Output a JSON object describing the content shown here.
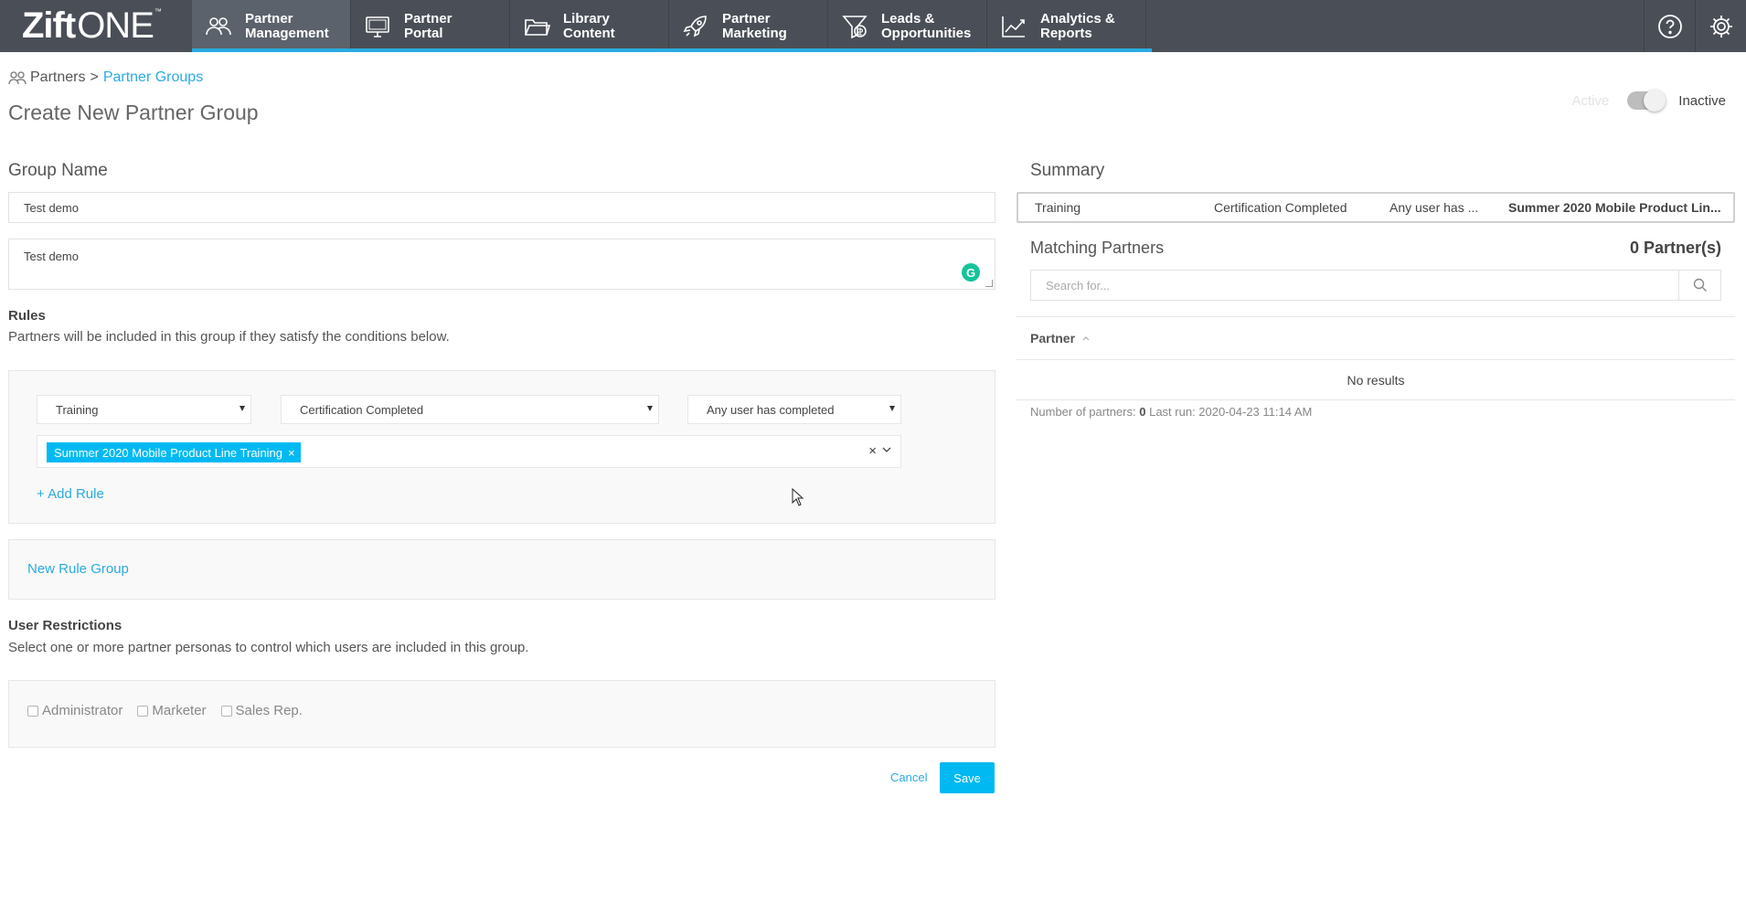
{
  "app": {
    "logo_main": "Zift",
    "logo_sub": "ONE",
    "logo_tm": "™"
  },
  "nav": {
    "tabs": [
      {
        "line1": "Partner",
        "line2": "Management",
        "icon": "partners-icon"
      },
      {
        "line1": "Partner",
        "line2": "Portal",
        "icon": "monitor-icon"
      },
      {
        "line1": "Library",
        "line2": "Content",
        "icon": "folder-icon"
      },
      {
        "line1": "Partner",
        "line2": "Marketing",
        "icon": "rocket-icon"
      },
      {
        "line1": "Leads &",
        "line2": "Opportunities",
        "icon": "money-funnel-icon"
      },
      {
        "line1": "Analytics &",
        "line2": "Reports",
        "icon": "chart-icon"
      }
    ],
    "help_icon": "help-icon",
    "settings_icon": "gear-icon",
    "accent": "#29abe2"
  },
  "breadcrumb": {
    "root": "Partners",
    "separator": ">",
    "current": "Partner Groups"
  },
  "page": {
    "title": "Create New Partner Group"
  },
  "status": {
    "active_label": "Active",
    "inactive_label": "Inactive"
  },
  "form": {
    "group_name_label": "Group Name",
    "group_name_value": "Test demo",
    "description_value": "Test demo",
    "rules_title": "Rules",
    "rules_desc": "Partners will be included in this group if they satisfy the conditions below.",
    "rule": {
      "type": "Training",
      "condition": "Certification Completed",
      "scope": "Any user has completed",
      "selected": "Summer 2020 Mobile Product Line Training",
      "chip_remove": "×",
      "clear": "×"
    },
    "add_rule": "+ Add Rule",
    "new_rule_group": "New Rule Group",
    "user_restrictions_title": "User Restrictions",
    "user_restrictions_desc": "Select one or more partner personas to control which users are included in this group.",
    "personas": [
      "Administrator",
      "Marketer",
      "Sales Rep."
    ],
    "cancel": "Cancel",
    "save": "Save"
  },
  "summary": {
    "title": "Summary",
    "items": [
      "Training",
      "Certification Completed",
      "Any user has ...",
      "Summer 2020 Mobile Product Lin..."
    ],
    "matching_title": "Matching Partners",
    "matching_count": "0 Partner(s)",
    "search_placeholder": "Search for...",
    "column_partner": "Partner",
    "no_results": "No results",
    "footer_prefix": "Number of partners:",
    "footer_count": "0",
    "footer_lastrun": "Last run: 2020-04-23 11:14 AM"
  }
}
